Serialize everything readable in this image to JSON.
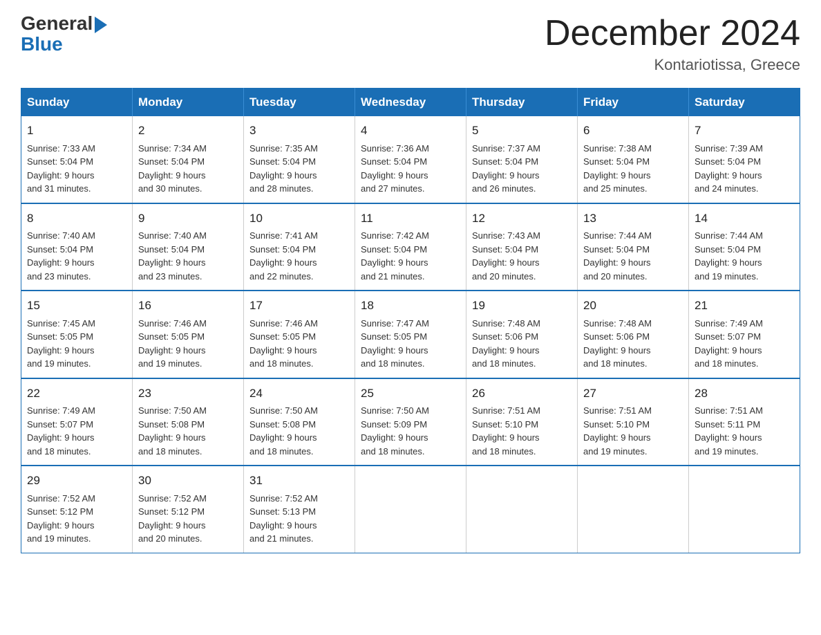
{
  "header": {
    "logo_general": "General",
    "logo_blue": "Blue",
    "month_title": "December 2024",
    "location": "Kontariotissa, Greece"
  },
  "days_of_week": [
    "Sunday",
    "Monday",
    "Tuesday",
    "Wednesday",
    "Thursday",
    "Friday",
    "Saturday"
  ],
  "weeks": [
    [
      {
        "day": "1",
        "sunrise": "7:33 AM",
        "sunset": "5:04 PM",
        "daylight": "9 hours and 31 minutes."
      },
      {
        "day": "2",
        "sunrise": "7:34 AM",
        "sunset": "5:04 PM",
        "daylight": "9 hours and 30 minutes."
      },
      {
        "day": "3",
        "sunrise": "7:35 AM",
        "sunset": "5:04 PM",
        "daylight": "9 hours and 28 minutes."
      },
      {
        "day": "4",
        "sunrise": "7:36 AM",
        "sunset": "5:04 PM",
        "daylight": "9 hours and 27 minutes."
      },
      {
        "day": "5",
        "sunrise": "7:37 AM",
        "sunset": "5:04 PM",
        "daylight": "9 hours and 26 minutes."
      },
      {
        "day": "6",
        "sunrise": "7:38 AM",
        "sunset": "5:04 PM",
        "daylight": "9 hours and 25 minutes."
      },
      {
        "day": "7",
        "sunrise": "7:39 AM",
        "sunset": "5:04 PM",
        "daylight": "9 hours and 24 minutes."
      }
    ],
    [
      {
        "day": "8",
        "sunrise": "7:40 AM",
        "sunset": "5:04 PM",
        "daylight": "9 hours and 23 minutes."
      },
      {
        "day": "9",
        "sunrise": "7:40 AM",
        "sunset": "5:04 PM",
        "daylight": "9 hours and 23 minutes."
      },
      {
        "day": "10",
        "sunrise": "7:41 AM",
        "sunset": "5:04 PM",
        "daylight": "9 hours and 22 minutes."
      },
      {
        "day": "11",
        "sunrise": "7:42 AM",
        "sunset": "5:04 PM",
        "daylight": "9 hours and 21 minutes."
      },
      {
        "day": "12",
        "sunrise": "7:43 AM",
        "sunset": "5:04 PM",
        "daylight": "9 hours and 20 minutes."
      },
      {
        "day": "13",
        "sunrise": "7:44 AM",
        "sunset": "5:04 PM",
        "daylight": "9 hours and 20 minutes."
      },
      {
        "day": "14",
        "sunrise": "7:44 AM",
        "sunset": "5:04 PM",
        "daylight": "9 hours and 19 minutes."
      }
    ],
    [
      {
        "day": "15",
        "sunrise": "7:45 AM",
        "sunset": "5:05 PM",
        "daylight": "9 hours and 19 minutes."
      },
      {
        "day": "16",
        "sunrise": "7:46 AM",
        "sunset": "5:05 PM",
        "daylight": "9 hours and 19 minutes."
      },
      {
        "day": "17",
        "sunrise": "7:46 AM",
        "sunset": "5:05 PM",
        "daylight": "9 hours and 18 minutes."
      },
      {
        "day": "18",
        "sunrise": "7:47 AM",
        "sunset": "5:05 PM",
        "daylight": "9 hours and 18 minutes."
      },
      {
        "day": "19",
        "sunrise": "7:48 AM",
        "sunset": "5:06 PM",
        "daylight": "9 hours and 18 minutes."
      },
      {
        "day": "20",
        "sunrise": "7:48 AM",
        "sunset": "5:06 PM",
        "daylight": "9 hours and 18 minutes."
      },
      {
        "day": "21",
        "sunrise": "7:49 AM",
        "sunset": "5:07 PM",
        "daylight": "9 hours and 18 minutes."
      }
    ],
    [
      {
        "day": "22",
        "sunrise": "7:49 AM",
        "sunset": "5:07 PM",
        "daylight": "9 hours and 18 minutes."
      },
      {
        "day": "23",
        "sunrise": "7:50 AM",
        "sunset": "5:08 PM",
        "daylight": "9 hours and 18 minutes."
      },
      {
        "day": "24",
        "sunrise": "7:50 AM",
        "sunset": "5:08 PM",
        "daylight": "9 hours and 18 minutes."
      },
      {
        "day": "25",
        "sunrise": "7:50 AM",
        "sunset": "5:09 PM",
        "daylight": "9 hours and 18 minutes."
      },
      {
        "day": "26",
        "sunrise": "7:51 AM",
        "sunset": "5:10 PM",
        "daylight": "9 hours and 18 minutes."
      },
      {
        "day": "27",
        "sunrise": "7:51 AM",
        "sunset": "5:10 PM",
        "daylight": "9 hours and 19 minutes."
      },
      {
        "day": "28",
        "sunrise": "7:51 AM",
        "sunset": "5:11 PM",
        "daylight": "9 hours and 19 minutes."
      }
    ],
    [
      {
        "day": "29",
        "sunrise": "7:52 AM",
        "sunset": "5:12 PM",
        "daylight": "9 hours and 19 minutes."
      },
      {
        "day": "30",
        "sunrise": "7:52 AM",
        "sunset": "5:12 PM",
        "daylight": "9 hours and 20 minutes."
      },
      {
        "day": "31",
        "sunrise": "7:52 AM",
        "sunset": "5:13 PM",
        "daylight": "9 hours and 21 minutes."
      },
      null,
      null,
      null,
      null
    ]
  ],
  "labels": {
    "sunrise": "Sunrise:",
    "sunset": "Sunset:",
    "daylight": "Daylight:"
  }
}
